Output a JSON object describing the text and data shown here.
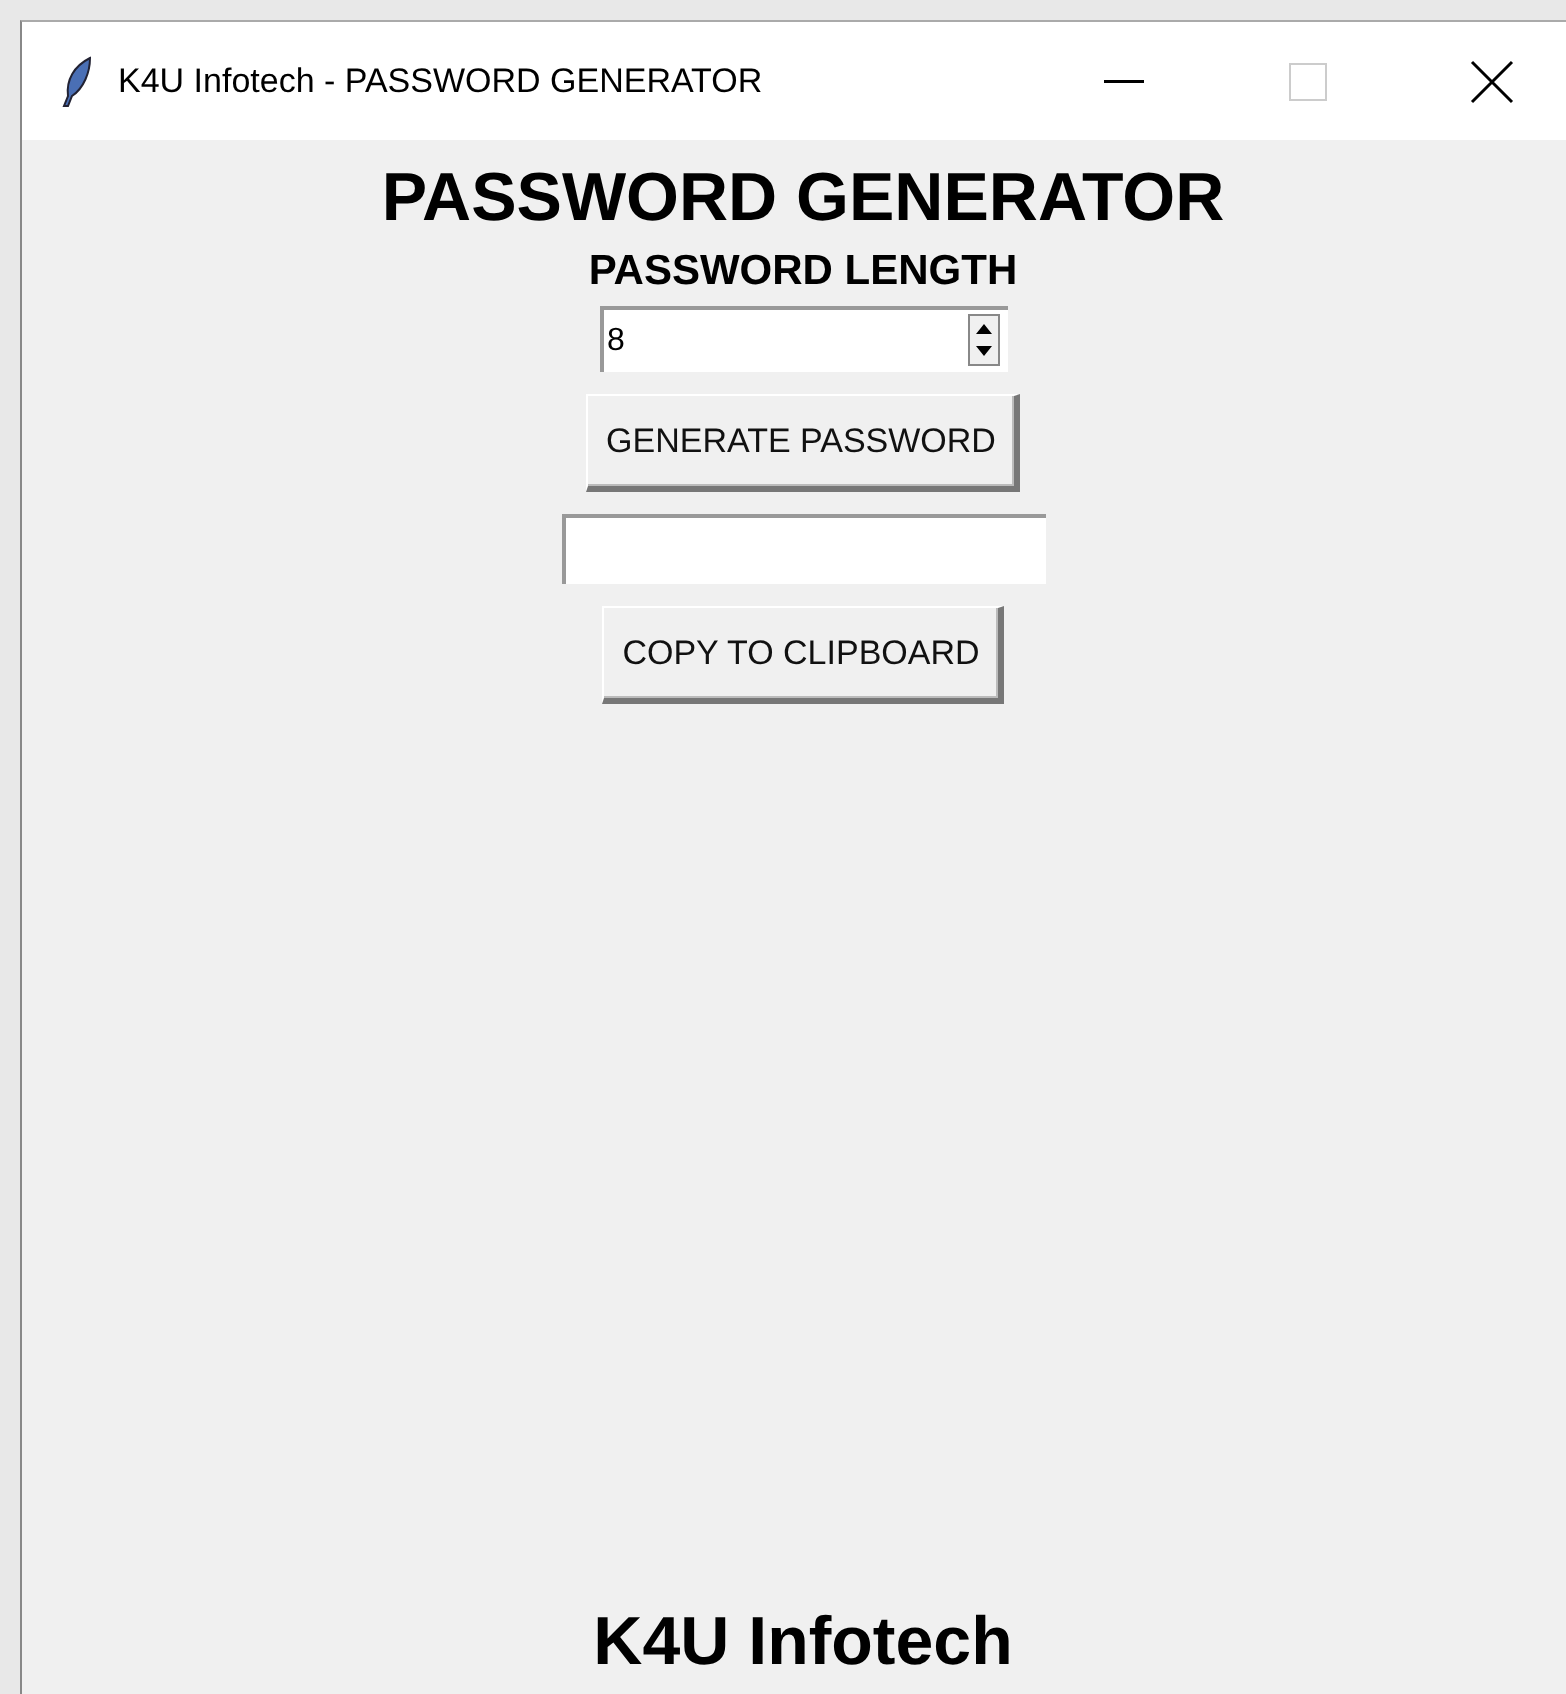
{
  "window": {
    "title": "K4U Infotech - PASSWORD GENERATOR"
  },
  "heading": "PASSWORD GENERATOR",
  "length_label": "PASSWORD LENGTH",
  "length_spinbox": {
    "value": "8"
  },
  "generate_button": "GENERATE PASSWORD",
  "copy_button": "COPY TO CLIPBOARD",
  "footer": "K4U Infotech"
}
